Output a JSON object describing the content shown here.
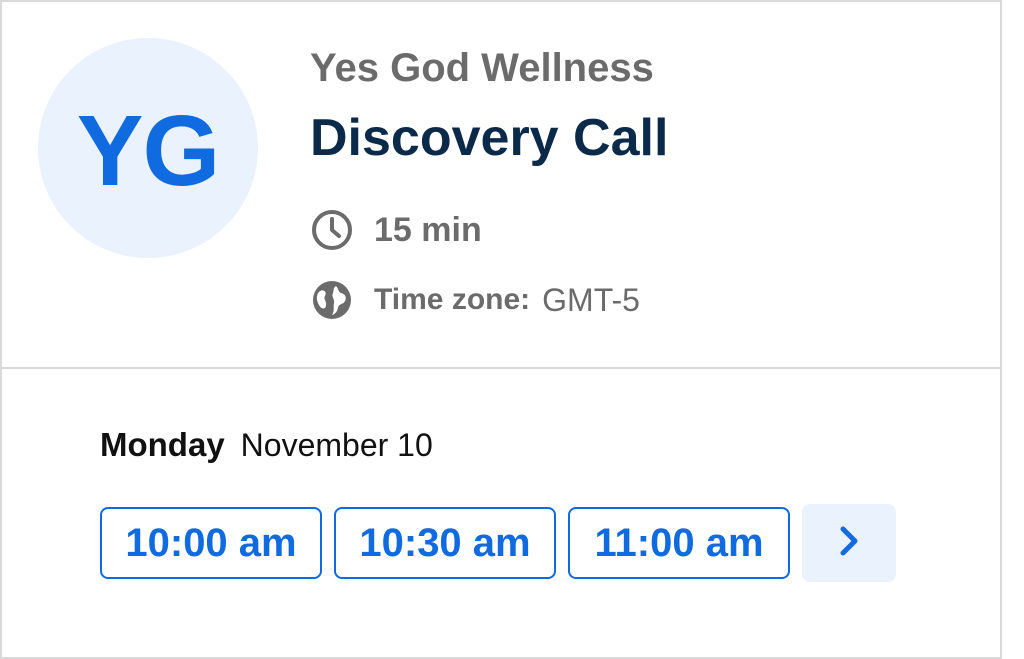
{
  "organizer": {
    "initials": "YG",
    "name": "Yes God Wellness"
  },
  "event": {
    "title": "Discovery Call",
    "duration": "15 min",
    "timezone_label": "Time zone:",
    "timezone_value": "GMT-5"
  },
  "schedule": {
    "day": "Monday",
    "date": "November 10",
    "slots": [
      "10:00 am",
      "10:30 am",
      "11:00 am"
    ],
    "next_icon": "chevron-right-icon"
  },
  "colors": {
    "accent": "#106ae0",
    "accent_bg": "#eaf2fd",
    "title": "#0b2a4a",
    "muted": "#6b6b6b",
    "border": "#d9d9d9"
  }
}
